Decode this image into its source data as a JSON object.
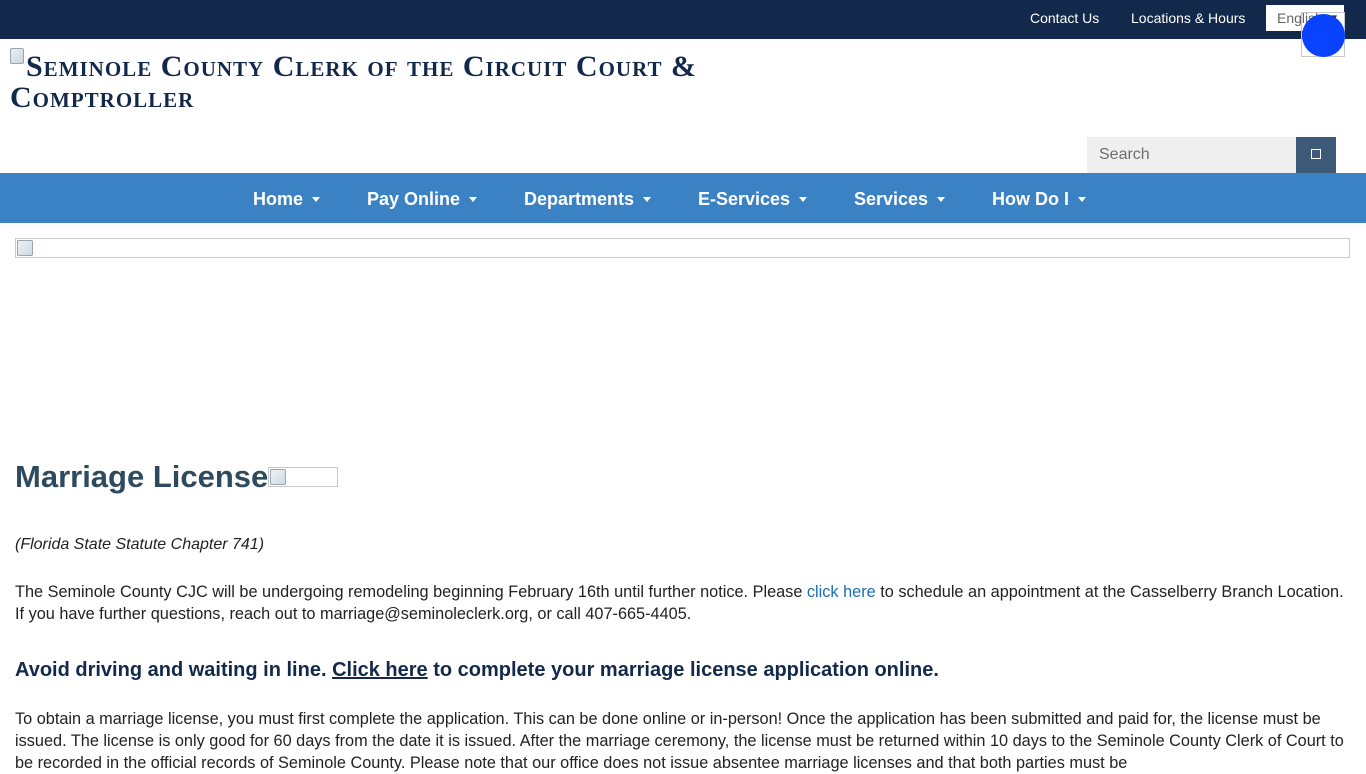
{
  "topbar": {
    "contact_label": "Contact Us",
    "locations_label": "Locations & Hours",
    "language_selected": "English"
  },
  "header": {
    "logo_alt": "Seminole County Clerk of the Circuit Court & Comptroller",
    "search_placeholder": "Search"
  },
  "nav": {
    "items": [
      {
        "label": "Home"
      },
      {
        "label": "Pay Online"
      },
      {
        "label": "Departments"
      },
      {
        "label": "E-Services"
      },
      {
        "label": "Services"
      },
      {
        "label": "How Do I"
      }
    ]
  },
  "main": {
    "title": "Marriage License",
    "statute": "(Florida State Statute Chapter 741)",
    "notice_before": "The Seminole County CJC will be undergoing remodeling beginning February 16th until further notice. Please ",
    "notice_link": "click here",
    "notice_after": " to schedule an appointment at the Casselberry Branch Location. If you have further questions, reach out to marriage@seminoleclerk.org, or call 407-665-4405.",
    "callout_before": "Avoid driving and waiting in line. ",
    "callout_link": "Click here",
    "callout_after": " to complete your marriage license application online.",
    "body_text": "To obtain a marriage license, you must first complete the application. This can be done online or in-person! Once the application has been submitted and paid for, the license must be issued. The license is only good for 60 days from the date it is issued. After the marriage ceremony, the license must be returned within 10 days to the Seminole County Clerk of Court to be recorded in the official records of Seminole County. Please note that our office does not issue absentee marriage licenses and that both parties must be"
  },
  "colors": {
    "topbar": "#13294b",
    "nav": "#3b82c4",
    "accent_button": "#3c5a78",
    "link": "#1a6fb5",
    "a11y_widget": "#0a43ff"
  }
}
